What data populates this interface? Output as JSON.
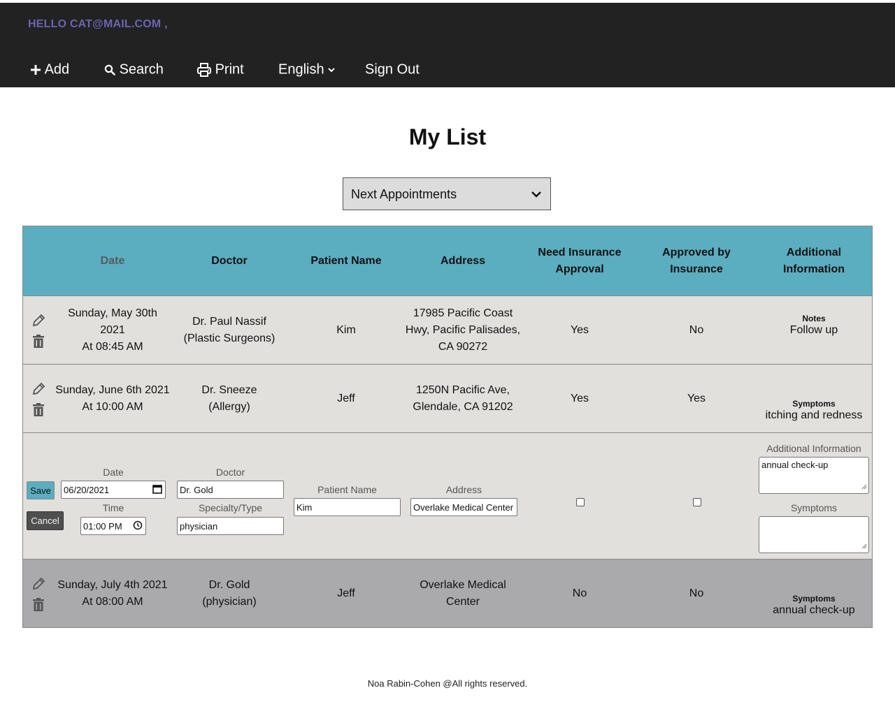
{
  "header": {
    "greeting": "HELLO CAT@MAIL.COM ,",
    "nav": {
      "add": "Add",
      "search": "Search",
      "print": "Print",
      "language": "English",
      "sign_out": "Sign Out"
    }
  },
  "main": {
    "title": "My List",
    "view_select": {
      "selected": "Next Appointments"
    }
  },
  "table": {
    "headers": {
      "date": "Date",
      "doctor": "Doctor",
      "patient": "Patient Name",
      "address": "Address",
      "need_insurance": "Need Insurance Approval",
      "approved": "Approved by Insurance",
      "additional": "Additional Information"
    },
    "rows": [
      {
        "date_line1": "Sunday, May 30th 2021",
        "date_line2": "At 08:45 AM",
        "doctor_line1": "Dr. Paul Nassif",
        "doctor_line2": "(Plastic Surgeons)",
        "patient": "Kim",
        "address": "17985 Pacific Coast Hwy, Pacific Palisades, CA 90272",
        "need_insurance": "Yes",
        "approved": "No",
        "info_label": "Notes",
        "info_value": "Follow up"
      },
      {
        "date_line1": "Sunday, June 6th 2021",
        "date_line2": "At 10:00 AM",
        "doctor_line1": "Dr. Sneeze",
        "doctor_line2": "(Allergy)",
        "patient": "Jeff",
        "address": "1250N Pacific Ave, Glendale, CA 91202",
        "need_insurance": "Yes",
        "approved": "Yes",
        "info_label": "Symptoms",
        "info_value": "itching and redness"
      },
      {
        "date_line1": "Sunday, July 4th 2021",
        "date_line2": "At 08:00 AM",
        "doctor_line1": "Dr. Gold",
        "doctor_line2": "(physician)",
        "patient": "Jeff",
        "address": "Overlake Medical Center",
        "need_insurance": "No",
        "approved": "No",
        "info_label": "Symptoms",
        "info_value": "annual check-up"
      }
    ],
    "edit_row": {
      "save_label": "Save",
      "cancel_label": "Cancel",
      "date_label": "Date",
      "date_value": "06/20/2021",
      "time_label": "Time",
      "time_value": "01:00 PM",
      "doctor_label": "Doctor",
      "doctor_value": "Dr. Gold",
      "specialty_label": "Specialty/Type",
      "specialty_value": "physician",
      "patient_label": "Patient Name",
      "patient_value": "Kim",
      "address_label": "Address",
      "address_value": "Overlake Medical Center",
      "need_insurance_checked": false,
      "approved_checked": false,
      "additional_label": "Additional Information",
      "additional_value": "annual check-up",
      "symptoms_label": "Symptoms",
      "symptoms_value": ""
    }
  },
  "footer": {
    "text": "Noa Rabin-Cohen @All rights reserved."
  },
  "colors": {
    "nav_bg": "#222222",
    "greeting": "#6a64b3",
    "table_header": "#5badc0",
    "row_bg": "#e1e0dc",
    "row_highlight": "#aaa9ab",
    "save_button": "#5badc0",
    "cancel_button": "#4f4f4f"
  },
  "icons": {
    "add": "plus-icon",
    "search": "magnifier-icon",
    "print": "printer-icon",
    "language": "chevron-down-icon",
    "edit": "pencil-icon",
    "delete": "trash-icon"
  }
}
